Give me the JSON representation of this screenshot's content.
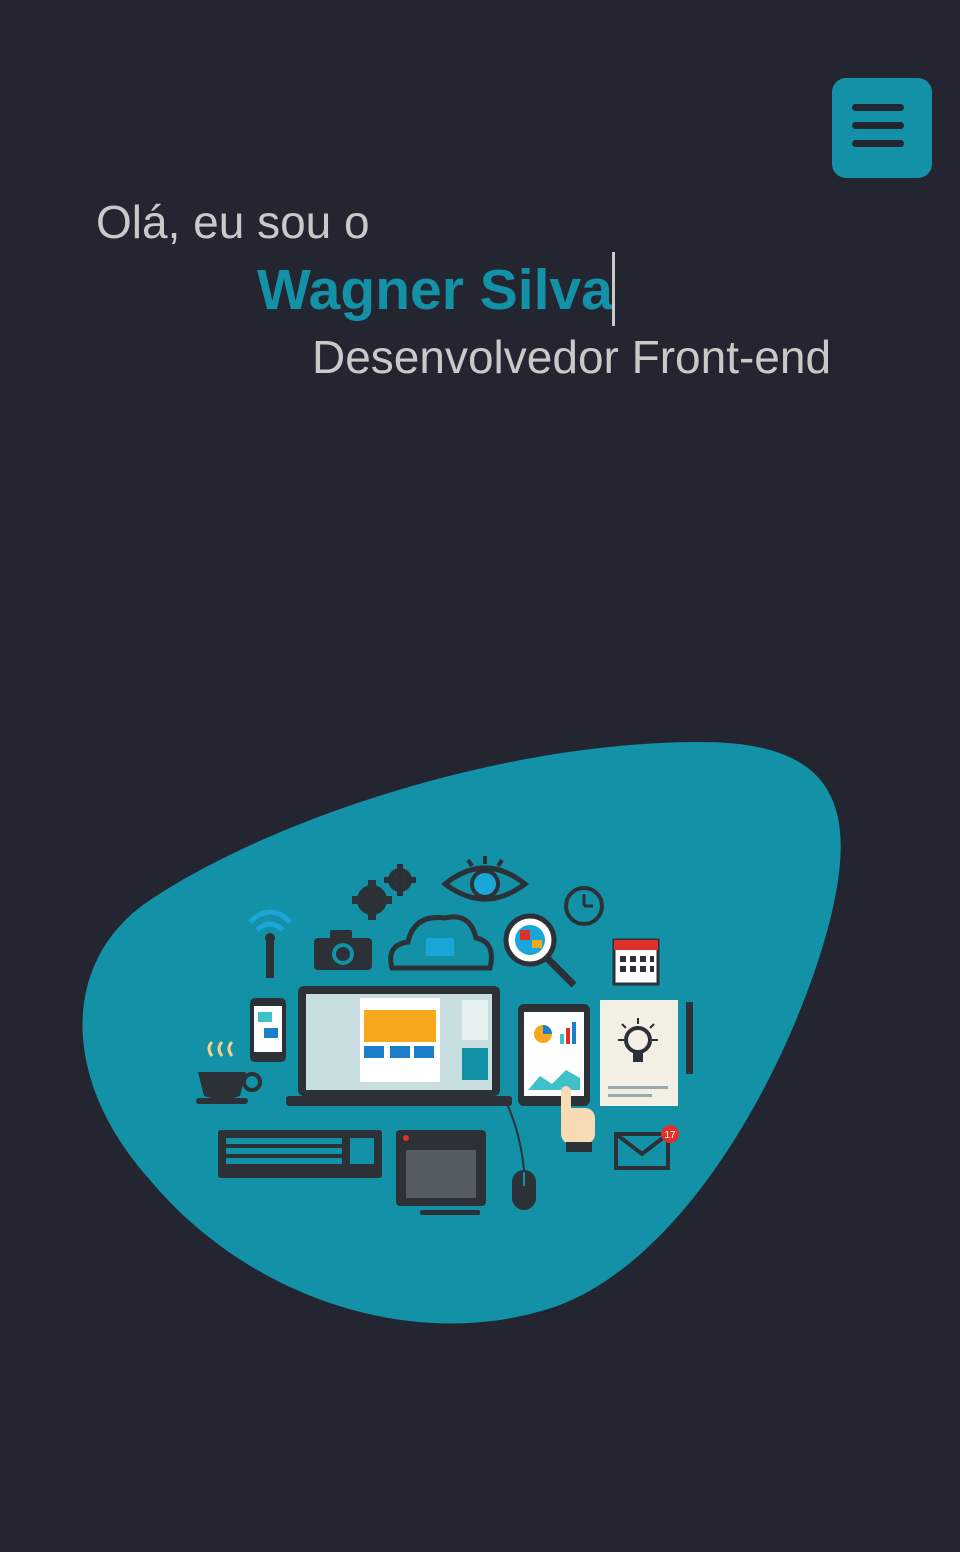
{
  "header": {
    "menu_icon": "hamburger-icon"
  },
  "hero": {
    "greeting": "Olá, eu sou o",
    "name": "Wagner Silva",
    "role": "Desenvolvedor Front-end"
  },
  "illustration": {
    "mail_badge_count": "17"
  },
  "colors": {
    "background": "#232530",
    "accent": "#1291a7",
    "text": "#c9c9c9"
  }
}
